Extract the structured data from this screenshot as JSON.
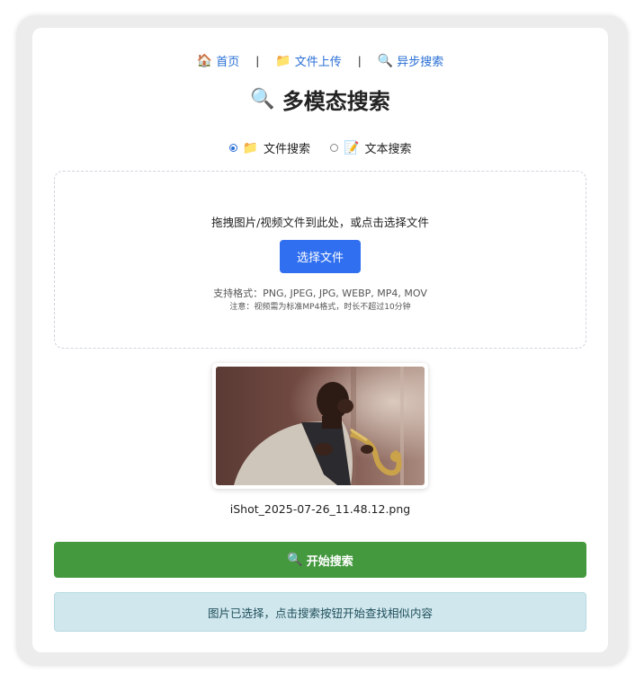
{
  "nav": {
    "items": [
      {
        "icon": "house-icon",
        "emoji": "🏠",
        "label": "首页"
      },
      {
        "icon": "folder-icon",
        "emoji": "📁",
        "label": "文件上传"
      },
      {
        "icon": "magnifier-icon",
        "emoji": "🔍",
        "label": "异步搜索"
      }
    ],
    "separator": "|"
  },
  "title": {
    "emoji": "🔍",
    "text": "多模态搜索"
  },
  "mode": {
    "selected": "file",
    "options": [
      {
        "emoji": "📁",
        "label": "文件搜索"
      },
      {
        "emoji": "📝",
        "label": "文本搜索"
      }
    ]
  },
  "dropzone": {
    "prompt": "拖拽图片/视频文件到此处，或点击选择文件",
    "button_label": "选择文件",
    "formats": "支持格式：PNG, JPEG, JPG, WEBP, MP4, MOV",
    "note": "注意：视频需为标准MP4格式，时长不超过10分钟"
  },
  "preview": {
    "filename": "iShot_2025-07-26_11.48.12.png"
  },
  "search_button": {
    "emoji": "🔍",
    "label": "开始搜索"
  },
  "status": {
    "message": "图片已选择，点击搜索按钮开始查找相似内容"
  },
  "colors": {
    "primary": "#2f6ff0",
    "success": "#44993f",
    "info_bg": "#d1e7ee",
    "link": "#2a6fd6"
  }
}
